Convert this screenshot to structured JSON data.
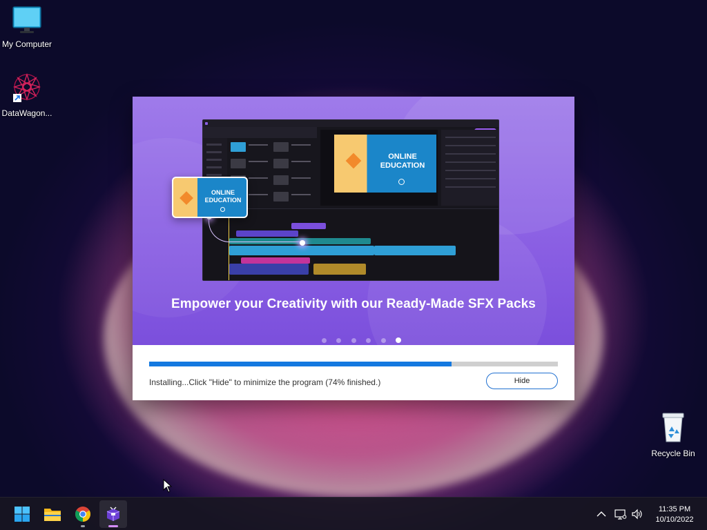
{
  "desktop": {
    "icons": [
      {
        "label": "My Computer",
        "icon": "monitor-icon"
      },
      {
        "label": "DataWagon...",
        "icon": "datawagon-shortcut-icon"
      },
      {
        "label": "Recycle Bin",
        "icon": "recycle-bin-icon"
      }
    ]
  },
  "installer": {
    "headline": "Empower your Creativity with our Ready-Made SFX Packs",
    "illustration_text": "ONLINE EDUCATION",
    "illustration_line1": "ONLINE",
    "illustration_line2": "EDUCATION",
    "carousel": {
      "count": 6,
      "active_index": 5
    },
    "progress_percent": 74,
    "status": "Installing...Click \"Hide\" to minimize the program (74% finished.)",
    "hide_label": "Hide",
    "colors": {
      "banner": "#8a5fe3",
      "progress_fill": "#1479e0",
      "progress_track": "#cfcfcf",
      "button_border": "#1e6fd0"
    }
  },
  "taskbar": {
    "apps": [
      {
        "name": "Start",
        "icon": "windows-start-icon"
      },
      {
        "name": "File Explorer",
        "icon": "folder-icon"
      },
      {
        "name": "Google Chrome",
        "icon": "chrome-icon"
      },
      {
        "name": "Installer",
        "icon": "installer-box-icon",
        "active": true
      }
    ],
    "tray": {
      "icons": [
        "chevron-up-icon",
        "network-icon",
        "volume-icon"
      ]
    },
    "clock": {
      "time": "11:35 PM",
      "date": "10/10/2022"
    }
  }
}
